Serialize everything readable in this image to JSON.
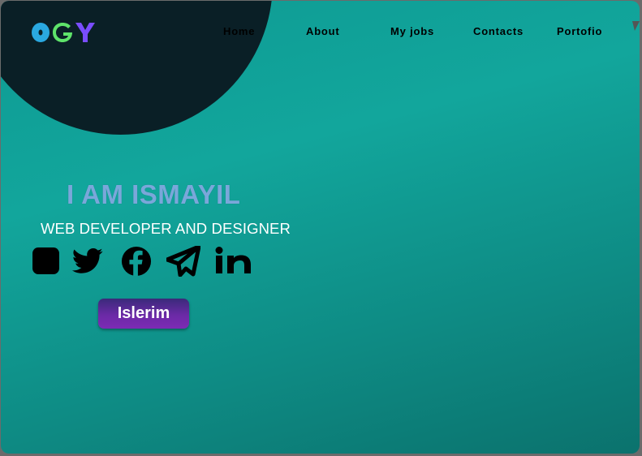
{
  "brand": {
    "logo_letters": [
      "O",
      "G",
      "Y"
    ],
    "colors": [
      "#2aa8e0",
      "#5ee36a",
      "#7a4dff"
    ]
  },
  "nav": {
    "items": [
      "Home",
      "About",
      "My jobs",
      "Contacts",
      "Portofio"
    ]
  },
  "hero": {
    "title": "I AM ISMAYIL",
    "subtitle": "WEB DEVELOPER AND DESIGNER",
    "cta_label": "Islerim"
  },
  "socials": [
    "instagram-icon",
    "twitter-icon",
    "facebook-icon",
    "telegram-icon",
    "linkedin-icon"
  ],
  "colors": {
    "background": "#109f97",
    "blob": "#0a1f26",
    "title": "#7aa7da",
    "button": "#6b2aa6"
  }
}
